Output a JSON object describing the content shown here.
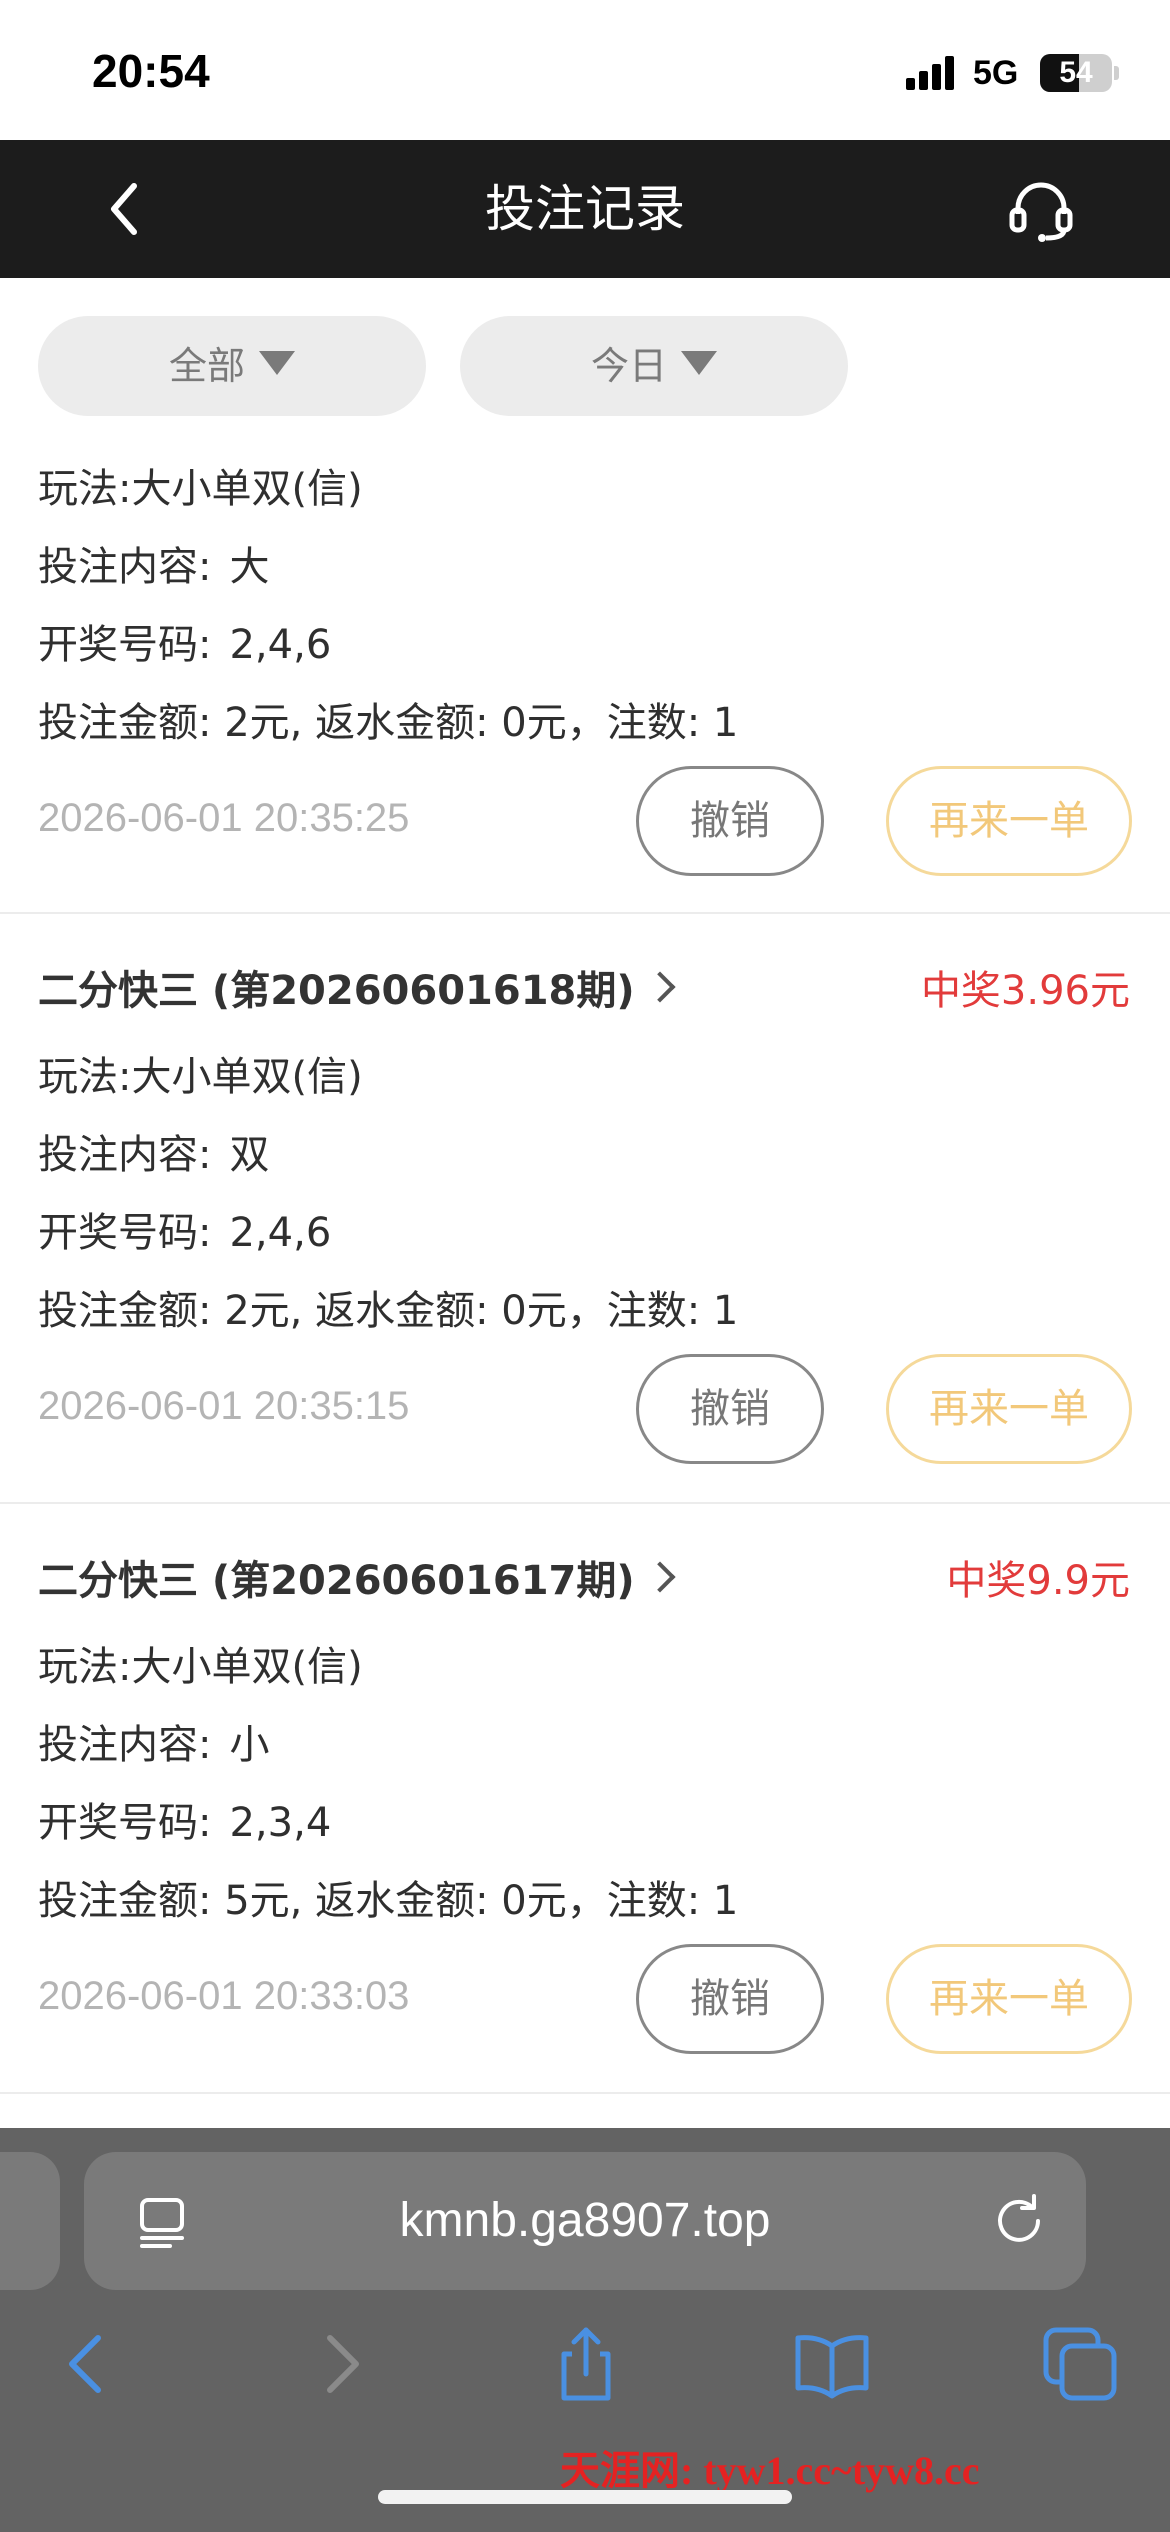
{
  "status_bar": {
    "time": "20:54",
    "network": "5G",
    "battery": "54",
    "battery_level": 0.54
  },
  "header": {
    "title": "投注记录"
  },
  "filters": [
    {
      "label": "全部"
    },
    {
      "label": "今日"
    }
  ],
  "records": [
    {
      "title": "",
      "prize": "",
      "play_label": "玩法:",
      "play_value": "大小单双(信)",
      "content_label": "投注内容:",
      "content_value": "大",
      "numbers_label": "开奖号码:",
      "numbers_value": "2,4,6",
      "amount_line": "投注金额: 2元, 返水金额: 0元，注数: 1",
      "time": "2026-06-01 20:35:25",
      "cancel_label": "撤销",
      "again_label": "再来一单"
    },
    {
      "title": "二分快三 (第20260601618期)",
      "prize": "中奖3.96元",
      "play_label": "玩法:",
      "play_value": "大小单双(信)",
      "content_label": "投注内容:",
      "content_value": "双",
      "numbers_label": "开奖号码:",
      "numbers_value": "2,4,6",
      "amount_line": "投注金额: 2元, 返水金额: 0元，注数: 1",
      "time": "2026-06-01 20:35:15",
      "cancel_label": "撤销",
      "again_label": "再来一单"
    },
    {
      "title": "二分快三 (第20260601617期)",
      "prize": "中奖9.9元",
      "play_label": "玩法:",
      "play_value": "大小单双(信)",
      "content_label": "投注内容:",
      "content_value": "小",
      "numbers_label": "开奖号码:",
      "numbers_value": "2,3,4",
      "amount_line": "投注金额: 5元, 返水金额: 0元，注数: 1",
      "time": "2026-06-01 20:33:03",
      "cancel_label": "撤销",
      "again_label": "再来一单"
    }
  ],
  "browser": {
    "url": "kmnb.ga8907.top"
  },
  "watermark": "天涯网: tyw1.cc~tyw8.cc",
  "colors": {
    "header_bg": "#1c1c1c",
    "prize": "#e23b3b",
    "again_border": "#f5d99a",
    "browser_accent": "#4a90e2"
  }
}
